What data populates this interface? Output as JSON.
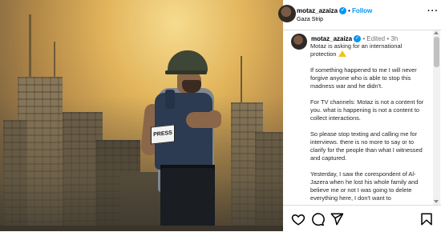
{
  "post": {
    "username": "motaz_azaiza",
    "follow_label": "Follow",
    "location": "Gaza Strip",
    "more_label": "···",
    "press_label": "PRESS"
  },
  "caption": {
    "username": "motaz_azaiza",
    "edited": "Edited",
    "time": "3h",
    "paragraphs": [
      "Motaz is asking for an international protection",
      "If something happened to me I will never forgive anyone who is able to stop this madness war and he didn't.",
      "For TV channels: Motaz is not a content for you. what is happening is not a content to collect interactions.",
      "So please stop texting and calling me for interviews. there is no more to say or to clarify for the people than what I witnessed and captured.",
      "Yesterday, I saw the corespondent of Al-Jazera when he lost his whole family and believe me or not I was going to delete everything here, I don't want to"
    ]
  },
  "icons": {
    "verified": "verified-badge-icon",
    "like": "heart-icon",
    "comment": "comment-icon",
    "share": "send-icon",
    "save": "bookmark-icon",
    "warning": "warning-icon"
  },
  "colors": {
    "accent": "#0095f6",
    "warning": "#f2c318"
  }
}
